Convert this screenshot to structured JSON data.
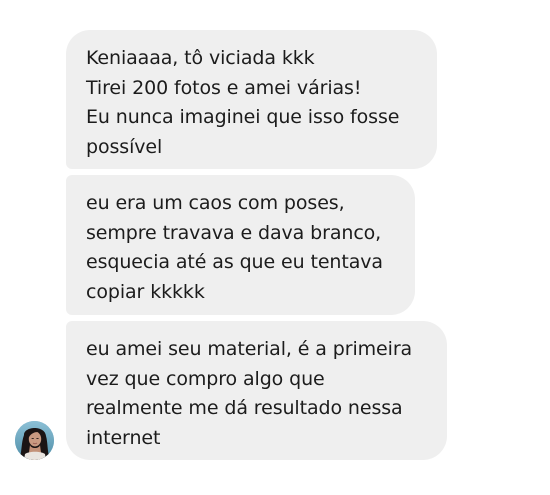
{
  "messages": [
    {
      "lines": [
        "Keniaaaa, tô viciada kkk",
        "Tirei 200 fotos e amei várias!",
        "Eu nunca imaginei que isso fosse",
        "possível"
      ]
    },
    {
      "lines": [
        "eu era um caos com poses,",
        "sempre travava e dava branco,",
        "esquecia até as que eu tentava",
        "copiar kkkkk"
      ]
    },
    {
      "lines": [
        "eu amei seu material, é a primeira",
        "vez que compro algo que",
        "realmente me dá resultado nessa",
        "internet"
      ]
    }
  ],
  "colors": {
    "bubble_background": "#efefef",
    "text": "#1c1c1c",
    "background": "#ffffff"
  },
  "icons": {
    "sender_avatar": "profile-photo"
  }
}
